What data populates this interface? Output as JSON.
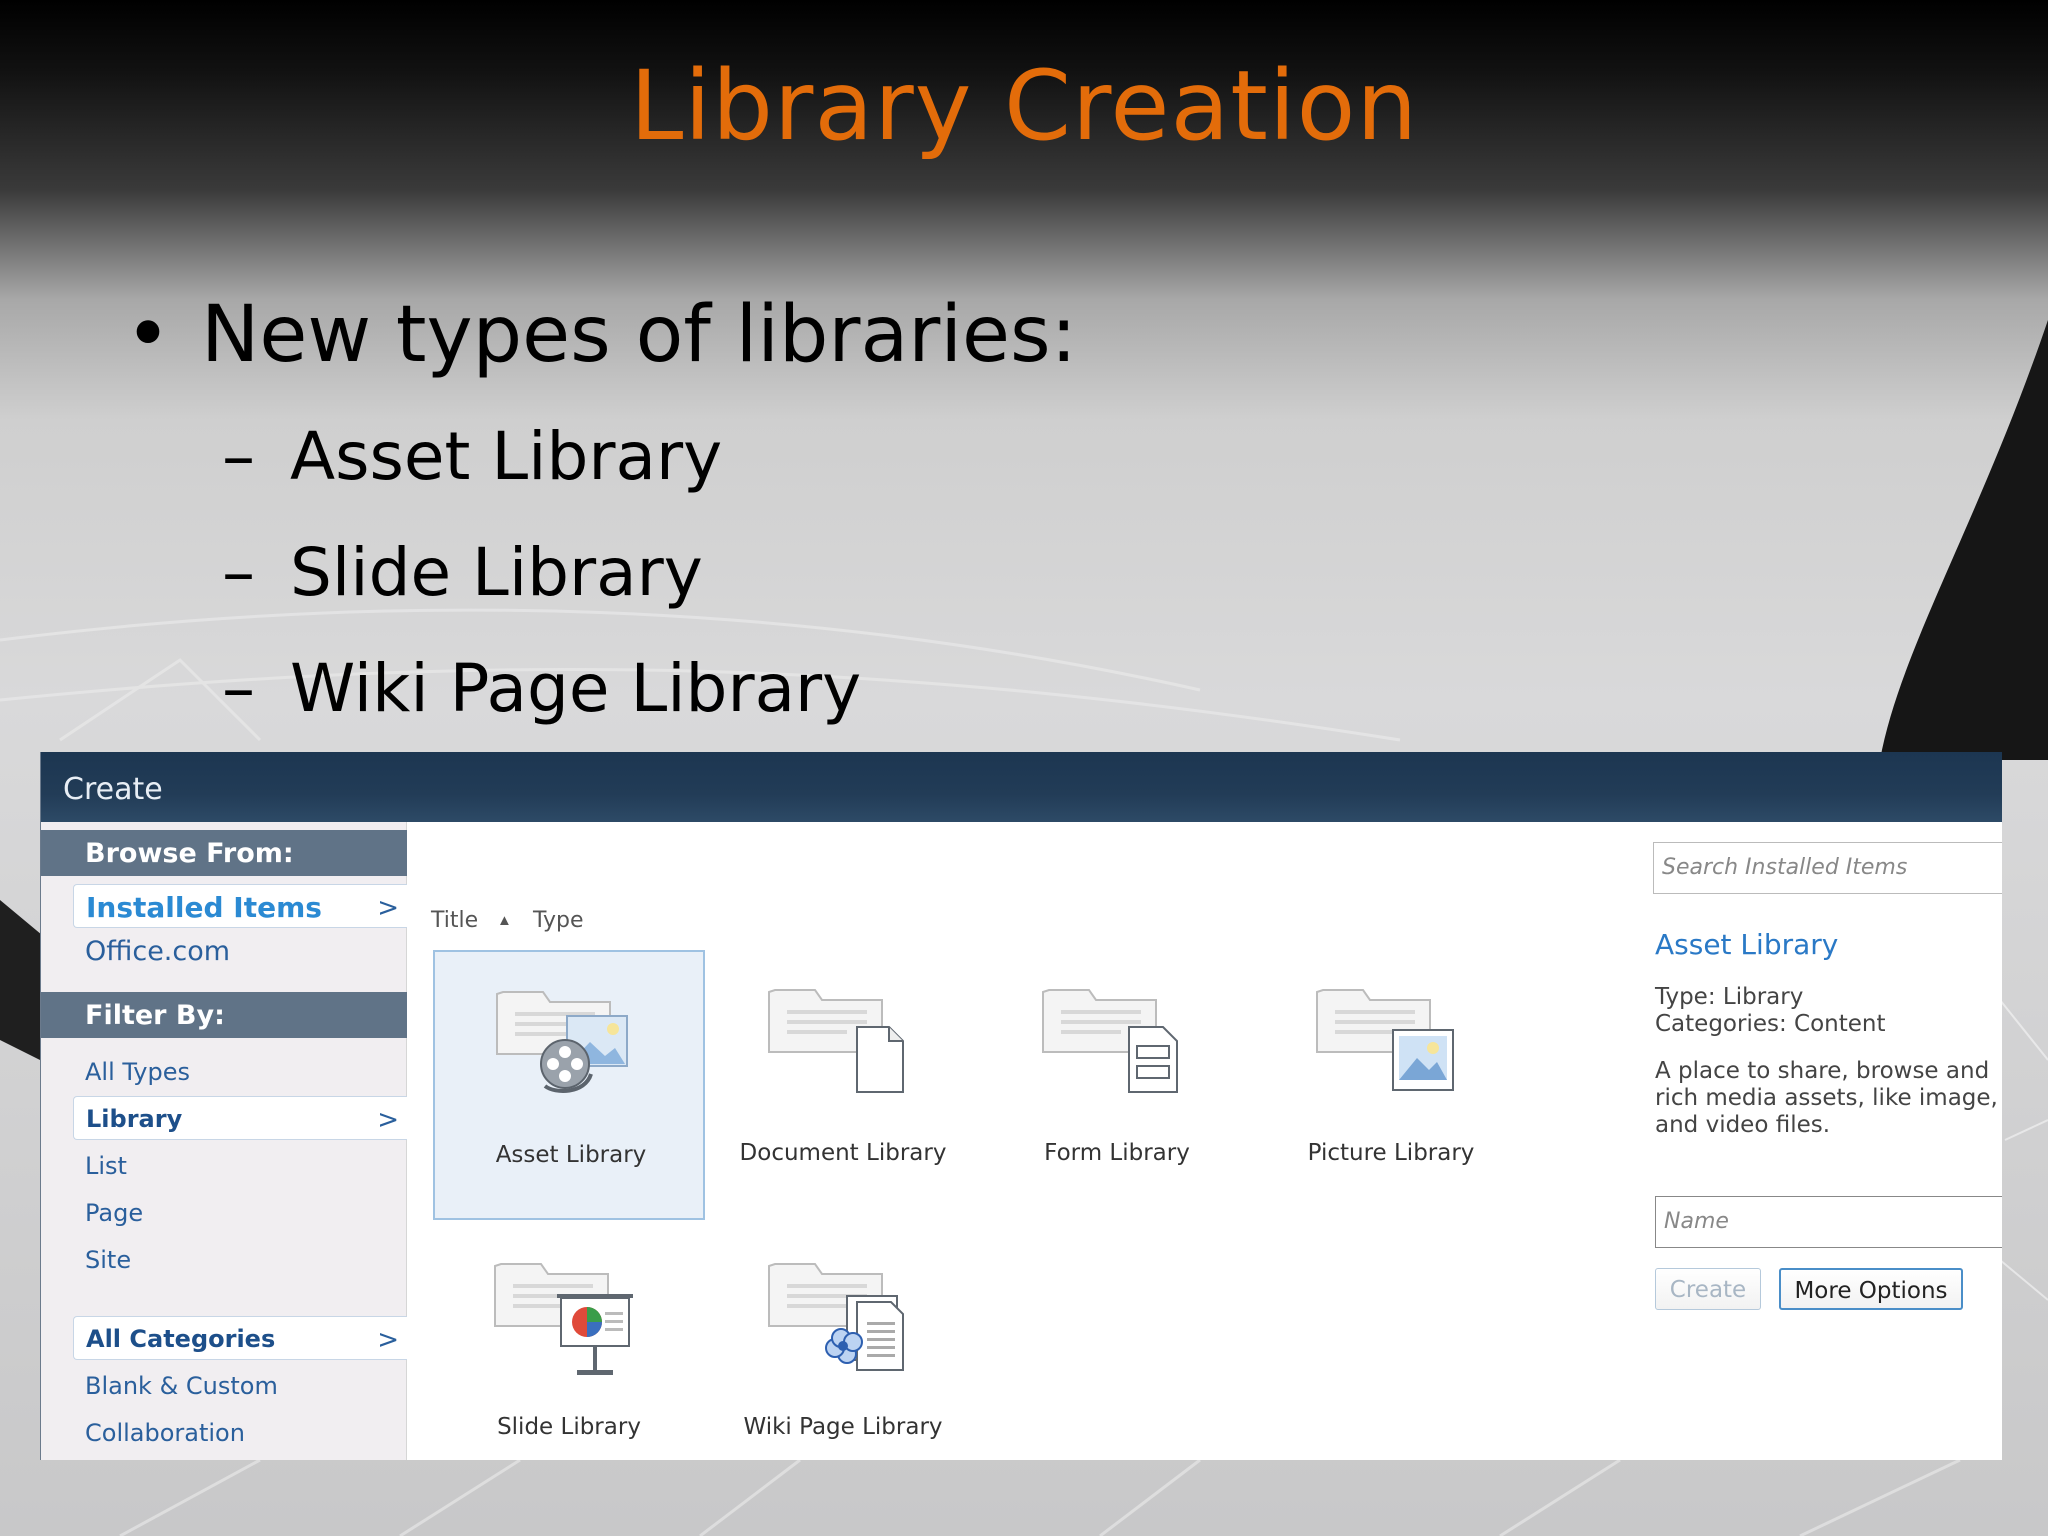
{
  "slide": {
    "title": "Library Creation",
    "bullet": "New types of libraries:",
    "bullet_marker": "•",
    "sub_marker": "–",
    "sub_items": [
      "Asset Library",
      "Slide Library",
      "Wiki Page Library"
    ],
    "colors": {
      "title": "#e36c0a",
      "text": "#000000"
    }
  },
  "dialog": {
    "title": "Create",
    "sidebar": {
      "browse_header": "Browse From:",
      "browse_items": [
        "Installed Items",
        "Office.com"
      ],
      "filter_header": "Filter By:",
      "filter_items": [
        "All Types",
        "Library",
        "List",
        "Page",
        "Site"
      ],
      "category_items": [
        "All Categories",
        "Blank & Custom",
        "Collaboration"
      ],
      "chevron": ">"
    },
    "columns": {
      "title": "Title",
      "type": "Type"
    },
    "tiles": [
      {
        "label": "Asset Library",
        "icon": "asset-library-icon",
        "selected": true
      },
      {
        "label": "Document Library",
        "icon": "document-library-icon"
      },
      {
        "label": "Form Library",
        "icon": "form-library-icon"
      },
      {
        "label": "Picture Library",
        "icon": "picture-library-icon"
      },
      {
        "label": "Slide Library",
        "icon": "slide-library-icon"
      },
      {
        "label": "Wiki Page Library",
        "icon": "wiki-page-library-icon"
      }
    ],
    "details": {
      "search_placeholder": "Search Installed Items",
      "selected_title": "Asset Library",
      "type_line": "Type: Library",
      "categories_line": "Categories: Content",
      "description_lines": [
        "A place to share, browse and",
        "rich media assets, like image,",
        "and video files."
      ],
      "name_placeholder": "Name",
      "create_label": "Create",
      "more_options_label": "More Options"
    },
    "colors": {
      "header": "#223c57",
      "sidebar_header": "#607387",
      "link": "#2a5f9c",
      "accent": "#2a79c6"
    }
  }
}
